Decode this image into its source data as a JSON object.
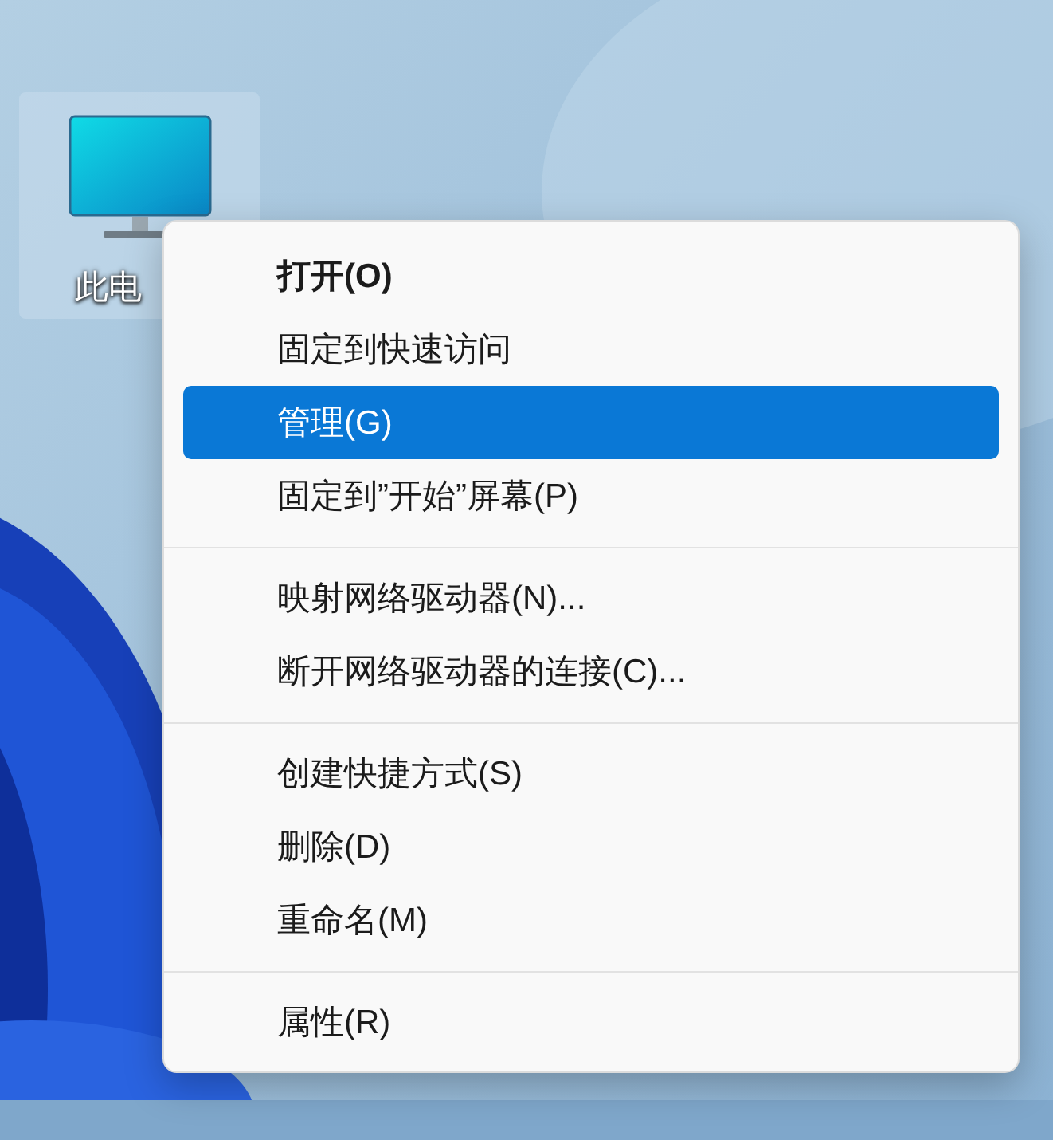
{
  "desktop_icon": {
    "label": "此电",
    "selected": true
  },
  "context_menu": {
    "items": [
      {
        "kind": "item",
        "label": "打开(O)",
        "bold": true,
        "selected": false
      },
      {
        "kind": "item",
        "label": "固定到快速访问",
        "bold": false,
        "selected": false
      },
      {
        "kind": "item",
        "label": "管理(G)",
        "bold": false,
        "selected": true
      },
      {
        "kind": "item",
        "label": "固定到”开始”屏幕(P)",
        "bold": false,
        "selected": false
      },
      {
        "kind": "separator"
      },
      {
        "kind": "item",
        "label": "映射网络驱动器(N)...",
        "bold": false,
        "selected": false
      },
      {
        "kind": "item",
        "label": "断开网络驱动器的连接(C)...",
        "bold": false,
        "selected": false
      },
      {
        "kind": "separator"
      },
      {
        "kind": "item",
        "label": "创建快捷方式(S)",
        "bold": false,
        "selected": false
      },
      {
        "kind": "item",
        "label": "删除(D)",
        "bold": false,
        "selected": false
      },
      {
        "kind": "item",
        "label": "重命名(M)",
        "bold": false,
        "selected": false
      },
      {
        "kind": "separator"
      },
      {
        "kind": "item",
        "label": "属性(R)",
        "bold": false,
        "selected": false
      }
    ]
  }
}
